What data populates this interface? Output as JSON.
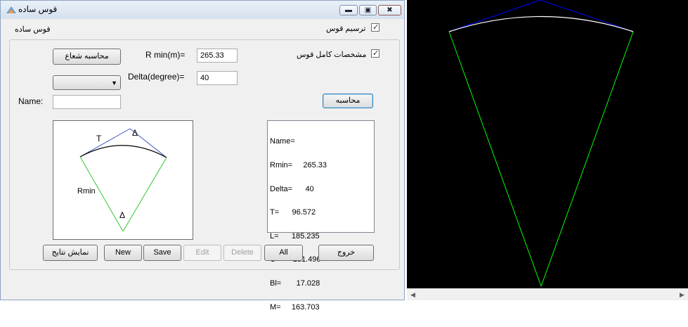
{
  "window": {
    "title": "قوس ساده",
    "controls": [
      "minimize-icon",
      "maximize-icon",
      "close-icon"
    ]
  },
  "top": {
    "caption": "قوس ساده",
    "draw_arc_label": "ترسیم قوس",
    "draw_arc_checked": true
  },
  "form": {
    "radius_button": "محاسبه شعاع",
    "rmin_label": "R min(m)=",
    "rmin_value": "265.33",
    "delta_label": "Delta(degree)=",
    "delta_value": "40",
    "full_specs_label": "مشخصات کامل قوس",
    "full_specs_checked": true,
    "dropdown_value": "",
    "name_label": "Name:",
    "name_value": "",
    "calculate_button": "محاسبه"
  },
  "diagram": {
    "t_label": "T",
    "delta_top": "Δ",
    "rmin_label": "Rmin",
    "delta_bottom": "Δ"
  },
  "results": [
    "Name=",
    "Rmin=     265.33",
    "Delta=      40",
    "T=      96.572",
    "L=      185.235",
    "C=      181.496",
    "Bl=       17.028",
    "M=     163.703"
  ],
  "buttons": {
    "show_results": "نمایش نتایج",
    "new": "New",
    "save": "Save",
    "edit": "Edit",
    "delete": "Delete",
    "all": "All",
    "exit": "خروج"
  },
  "colors": {
    "tangent": "#0000ff",
    "arc": "#ffffff",
    "radius": "#00ff00",
    "canvas_bg": "#000000"
  }
}
